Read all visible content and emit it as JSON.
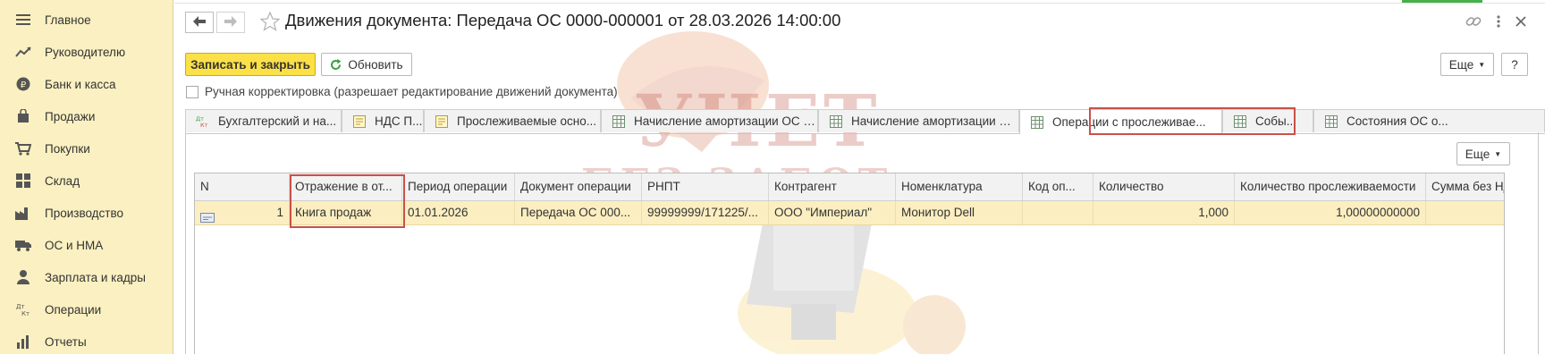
{
  "sidebar": {
    "items": [
      {
        "label": "Главное",
        "icon": "menu-icon"
      },
      {
        "label": "Руководителю",
        "icon": "trend-icon"
      },
      {
        "label": "Банк и касса",
        "icon": "coin-icon"
      },
      {
        "label": "Продажи",
        "icon": "bag-icon"
      },
      {
        "label": "Покупки",
        "icon": "cart-icon"
      },
      {
        "label": "Склад",
        "icon": "warehouse-icon"
      },
      {
        "label": "Производство",
        "icon": "factory-icon"
      },
      {
        "label": "ОС и НМА",
        "icon": "truck-icon"
      },
      {
        "label": "Зарплата и кадры",
        "icon": "person-icon"
      },
      {
        "label": "Операции",
        "icon": "dt-kt-icon"
      },
      {
        "label": "Отчеты",
        "icon": "chart-icon"
      }
    ]
  },
  "header": {
    "title": "Движения документа: Передача ОС 0000-000001 от 28.03.2026 14:00:00"
  },
  "toolbar": {
    "save_close_label": "Записать и закрыть",
    "refresh_label": "Обновить",
    "more_label": "Еще",
    "help_label": "?"
  },
  "manual_edit": {
    "label": "Ручная корректировка (разрешает редактирование движений документа)",
    "checked": false
  },
  "tabs": [
    {
      "label": "Бухгалтерский и на..."
    },
    {
      "label": "НДС П..."
    },
    {
      "label": "Прослеживаемые осно..."
    },
    {
      "label": "Начисление амортизации ОС (б..."
    },
    {
      "label": "Начисление амортизации ОС..."
    },
    {
      "label": "Операции с прослеживае..."
    },
    {
      "label": "Собы..."
    },
    {
      "label": "Состояния ОС о..."
    }
  ],
  "grid": {
    "more_label": "Еще",
    "columns": [
      "N",
      "Отражение в от...",
      "Период операции",
      "Документ операции",
      "РНПТ",
      "Контрагент",
      "Номенклатура",
      "Код оп...",
      "Количество",
      "Количество прослеживаемости",
      "Сумма без НДС"
    ],
    "rows": [
      {
        "n": "1",
        "reflection": "Книга продаж",
        "period": "01.01.2026",
        "document": "Передача ОС 000...",
        "rnpt": "99999999/171225/...",
        "counterparty": "ООО \"Империал\"",
        "nomenclature": "Монитор Dell",
        "op_code": "",
        "quantity": "1,000",
        "trace_quantity": "1,00000000000",
        "sum": ""
      }
    ]
  },
  "watermark": {
    "line1": "УЧЕТ",
    "line2": "БЕЗ ЗАБОТ"
  },
  "colors": {
    "sidebar_bg": "#fbf0c1",
    "primary_button": "#fbe047",
    "selected_row": "#fbeec0",
    "highlight_frame": "#c9504a"
  }
}
